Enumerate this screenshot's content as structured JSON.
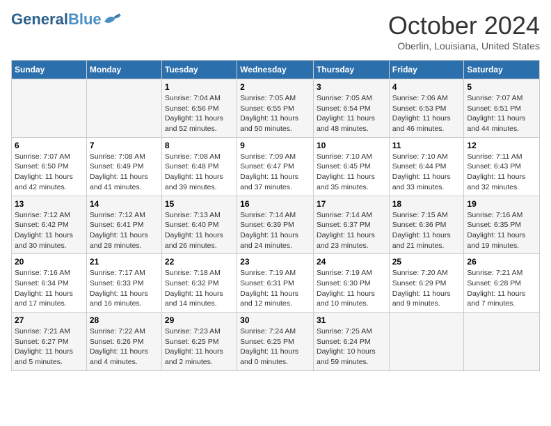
{
  "header": {
    "logo_line1": "General",
    "logo_line2": "Blue",
    "month_title": "October 2024",
    "location": "Oberlin, Louisiana, United States"
  },
  "days_of_week": [
    "Sunday",
    "Monday",
    "Tuesday",
    "Wednesday",
    "Thursday",
    "Friday",
    "Saturday"
  ],
  "weeks": [
    [
      {
        "day": "",
        "sunrise": "",
        "sunset": "",
        "daylight": ""
      },
      {
        "day": "",
        "sunrise": "",
        "sunset": "",
        "daylight": ""
      },
      {
        "day": "1",
        "sunrise": "Sunrise: 7:04 AM",
        "sunset": "Sunset: 6:56 PM",
        "daylight": "Daylight: 11 hours and 52 minutes."
      },
      {
        "day": "2",
        "sunrise": "Sunrise: 7:05 AM",
        "sunset": "Sunset: 6:55 PM",
        "daylight": "Daylight: 11 hours and 50 minutes."
      },
      {
        "day": "3",
        "sunrise": "Sunrise: 7:05 AM",
        "sunset": "Sunset: 6:54 PM",
        "daylight": "Daylight: 11 hours and 48 minutes."
      },
      {
        "day": "4",
        "sunrise": "Sunrise: 7:06 AM",
        "sunset": "Sunset: 6:53 PM",
        "daylight": "Daylight: 11 hours and 46 minutes."
      },
      {
        "day": "5",
        "sunrise": "Sunrise: 7:07 AM",
        "sunset": "Sunset: 6:51 PM",
        "daylight": "Daylight: 11 hours and 44 minutes."
      }
    ],
    [
      {
        "day": "6",
        "sunrise": "Sunrise: 7:07 AM",
        "sunset": "Sunset: 6:50 PM",
        "daylight": "Daylight: 11 hours and 42 minutes."
      },
      {
        "day": "7",
        "sunrise": "Sunrise: 7:08 AM",
        "sunset": "Sunset: 6:49 PM",
        "daylight": "Daylight: 11 hours and 41 minutes."
      },
      {
        "day": "8",
        "sunrise": "Sunrise: 7:08 AM",
        "sunset": "Sunset: 6:48 PM",
        "daylight": "Daylight: 11 hours and 39 minutes."
      },
      {
        "day": "9",
        "sunrise": "Sunrise: 7:09 AM",
        "sunset": "Sunset: 6:47 PM",
        "daylight": "Daylight: 11 hours and 37 minutes."
      },
      {
        "day": "10",
        "sunrise": "Sunrise: 7:10 AM",
        "sunset": "Sunset: 6:45 PM",
        "daylight": "Daylight: 11 hours and 35 minutes."
      },
      {
        "day": "11",
        "sunrise": "Sunrise: 7:10 AM",
        "sunset": "Sunset: 6:44 PM",
        "daylight": "Daylight: 11 hours and 33 minutes."
      },
      {
        "day": "12",
        "sunrise": "Sunrise: 7:11 AM",
        "sunset": "Sunset: 6:43 PM",
        "daylight": "Daylight: 11 hours and 32 minutes."
      }
    ],
    [
      {
        "day": "13",
        "sunrise": "Sunrise: 7:12 AM",
        "sunset": "Sunset: 6:42 PM",
        "daylight": "Daylight: 11 hours and 30 minutes."
      },
      {
        "day": "14",
        "sunrise": "Sunrise: 7:12 AM",
        "sunset": "Sunset: 6:41 PM",
        "daylight": "Daylight: 11 hours and 28 minutes."
      },
      {
        "day": "15",
        "sunrise": "Sunrise: 7:13 AM",
        "sunset": "Sunset: 6:40 PM",
        "daylight": "Daylight: 11 hours and 26 minutes."
      },
      {
        "day": "16",
        "sunrise": "Sunrise: 7:14 AM",
        "sunset": "Sunset: 6:39 PM",
        "daylight": "Daylight: 11 hours and 24 minutes."
      },
      {
        "day": "17",
        "sunrise": "Sunrise: 7:14 AM",
        "sunset": "Sunset: 6:37 PM",
        "daylight": "Daylight: 11 hours and 23 minutes."
      },
      {
        "day": "18",
        "sunrise": "Sunrise: 7:15 AM",
        "sunset": "Sunset: 6:36 PM",
        "daylight": "Daylight: 11 hours and 21 minutes."
      },
      {
        "day": "19",
        "sunrise": "Sunrise: 7:16 AM",
        "sunset": "Sunset: 6:35 PM",
        "daylight": "Daylight: 11 hours and 19 minutes."
      }
    ],
    [
      {
        "day": "20",
        "sunrise": "Sunrise: 7:16 AM",
        "sunset": "Sunset: 6:34 PM",
        "daylight": "Daylight: 11 hours and 17 minutes."
      },
      {
        "day": "21",
        "sunrise": "Sunrise: 7:17 AM",
        "sunset": "Sunset: 6:33 PM",
        "daylight": "Daylight: 11 hours and 16 minutes."
      },
      {
        "day": "22",
        "sunrise": "Sunrise: 7:18 AM",
        "sunset": "Sunset: 6:32 PM",
        "daylight": "Daylight: 11 hours and 14 minutes."
      },
      {
        "day": "23",
        "sunrise": "Sunrise: 7:19 AM",
        "sunset": "Sunset: 6:31 PM",
        "daylight": "Daylight: 11 hours and 12 minutes."
      },
      {
        "day": "24",
        "sunrise": "Sunrise: 7:19 AM",
        "sunset": "Sunset: 6:30 PM",
        "daylight": "Daylight: 11 hours and 10 minutes."
      },
      {
        "day": "25",
        "sunrise": "Sunrise: 7:20 AM",
        "sunset": "Sunset: 6:29 PM",
        "daylight": "Daylight: 11 hours and 9 minutes."
      },
      {
        "day": "26",
        "sunrise": "Sunrise: 7:21 AM",
        "sunset": "Sunset: 6:28 PM",
        "daylight": "Daylight: 11 hours and 7 minutes."
      }
    ],
    [
      {
        "day": "27",
        "sunrise": "Sunrise: 7:21 AM",
        "sunset": "Sunset: 6:27 PM",
        "daylight": "Daylight: 11 hours and 5 minutes."
      },
      {
        "day": "28",
        "sunrise": "Sunrise: 7:22 AM",
        "sunset": "Sunset: 6:26 PM",
        "daylight": "Daylight: 11 hours and 4 minutes."
      },
      {
        "day": "29",
        "sunrise": "Sunrise: 7:23 AM",
        "sunset": "Sunset: 6:25 PM",
        "daylight": "Daylight: 11 hours and 2 minutes."
      },
      {
        "day": "30",
        "sunrise": "Sunrise: 7:24 AM",
        "sunset": "Sunset: 6:25 PM",
        "daylight": "Daylight: 11 hours and 0 minutes."
      },
      {
        "day": "31",
        "sunrise": "Sunrise: 7:25 AM",
        "sunset": "Sunset: 6:24 PM",
        "daylight": "Daylight: 10 hours and 59 minutes."
      },
      {
        "day": "",
        "sunrise": "",
        "sunset": "",
        "daylight": ""
      },
      {
        "day": "",
        "sunrise": "",
        "sunset": "",
        "daylight": ""
      }
    ]
  ]
}
